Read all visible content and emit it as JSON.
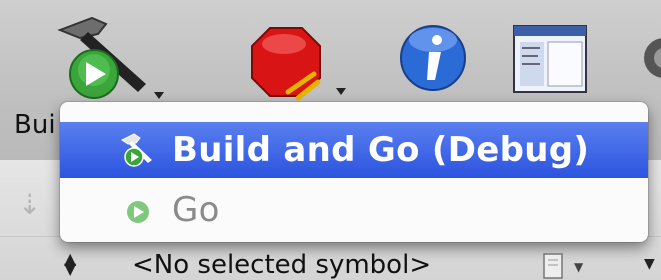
{
  "toolbar": {
    "build_label": "Bui",
    "buttons": [
      "hammer-build-icon",
      "stop-icon",
      "info-icon",
      "editor-icon"
    ]
  },
  "menu": {
    "items": [
      {
        "label": "Build and Go (Debug)",
        "selected": true,
        "icon": "build-and-go-icon"
      },
      {
        "label": "Go",
        "selected": false,
        "icon": "go-icon"
      }
    ]
  },
  "symbol_bar": {
    "label": "<No selected symbol>"
  },
  "colors": {
    "selection": "#2c54de",
    "stop": "#d81414",
    "info": "#2a6bd6",
    "go": "#3aa53a"
  }
}
